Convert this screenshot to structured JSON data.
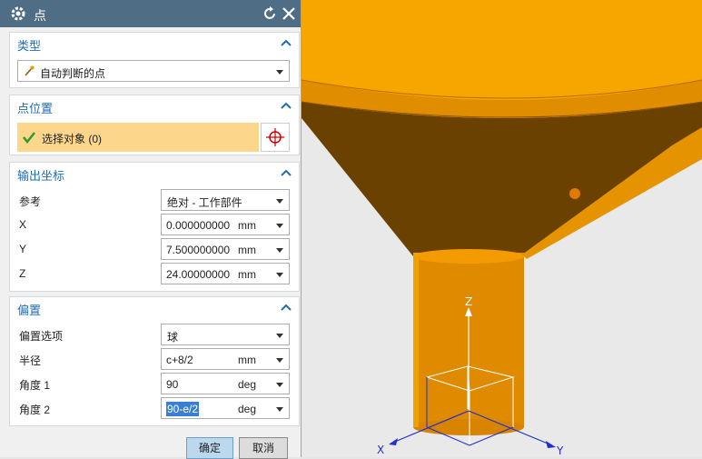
{
  "dialog": {
    "title": "点",
    "type_section": {
      "title": "类型",
      "selected": "自动判断的点"
    },
    "point_location": {
      "title": "点位置",
      "select_object_label": "选择对象 (0)"
    },
    "output_coords": {
      "title": "输出坐标",
      "reference_label": "参考",
      "reference_value": "绝对 - 工作部件",
      "rows": [
        {
          "label": "X",
          "value": "0.000000000",
          "unit": "mm"
        },
        {
          "label": "Y",
          "value": "7.500000000",
          "unit": "mm"
        },
        {
          "label": "Z",
          "value": "24.00000000",
          "unit": "mm"
        }
      ]
    },
    "offset": {
      "title": "偏置",
      "option_label": "偏置选项",
      "option_value": "球",
      "rows": [
        {
          "label": "半径",
          "value": "c+8/2",
          "unit": "mm"
        },
        {
          "label": "角度 1",
          "value": "90",
          "unit": "deg"
        },
        {
          "label": "角度 2",
          "value": "90-e/2",
          "unit": "deg"
        }
      ]
    },
    "ok_label": "确定",
    "cancel_label": "取消"
  },
  "viewport": {
    "axes": {
      "x": "X",
      "y": "Y",
      "z": "Z"
    }
  },
  "colors": {
    "titlebar": "#4f6d84",
    "section_title": "#1f6cb4",
    "select_highlight": "#fcd68a",
    "model_orange": "#f7a600",
    "model_dark": "#6b4100",
    "axis_blue": "#1f2fd0"
  }
}
